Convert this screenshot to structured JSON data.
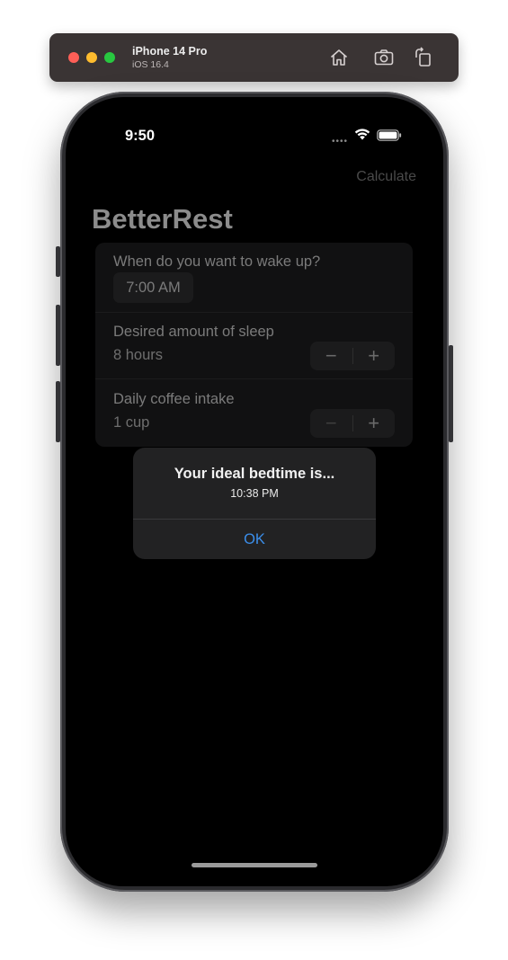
{
  "simulator": {
    "device_name": "iPhone 14 Pro",
    "os_version": "iOS 16.4",
    "icons": [
      "home-icon",
      "screenshot-icon",
      "rotate-icon"
    ]
  },
  "status_bar": {
    "time": "9:50",
    "icons": [
      "cellular-dots-icon",
      "wifi-icon",
      "battery-icon"
    ]
  },
  "nav": {
    "action_label": "Calculate",
    "title": "BetterRest"
  },
  "form": {
    "wake_up": {
      "label": "When do you want to wake up?",
      "value": "7:00 AM"
    },
    "sleep": {
      "label": "Desired amount of sleep",
      "value": "8 hours"
    },
    "coffee": {
      "label": "Daily coffee intake",
      "value": "1 cup"
    },
    "stepper": {
      "minus": "−",
      "plus": "+"
    }
  },
  "alert": {
    "title": "Your ideal bedtime is...",
    "message": "10:38 PM",
    "button": "OK"
  },
  "colors": {
    "accent": "#3b8eea",
    "screen_background": "#000000",
    "alert_background": "#222223"
  }
}
